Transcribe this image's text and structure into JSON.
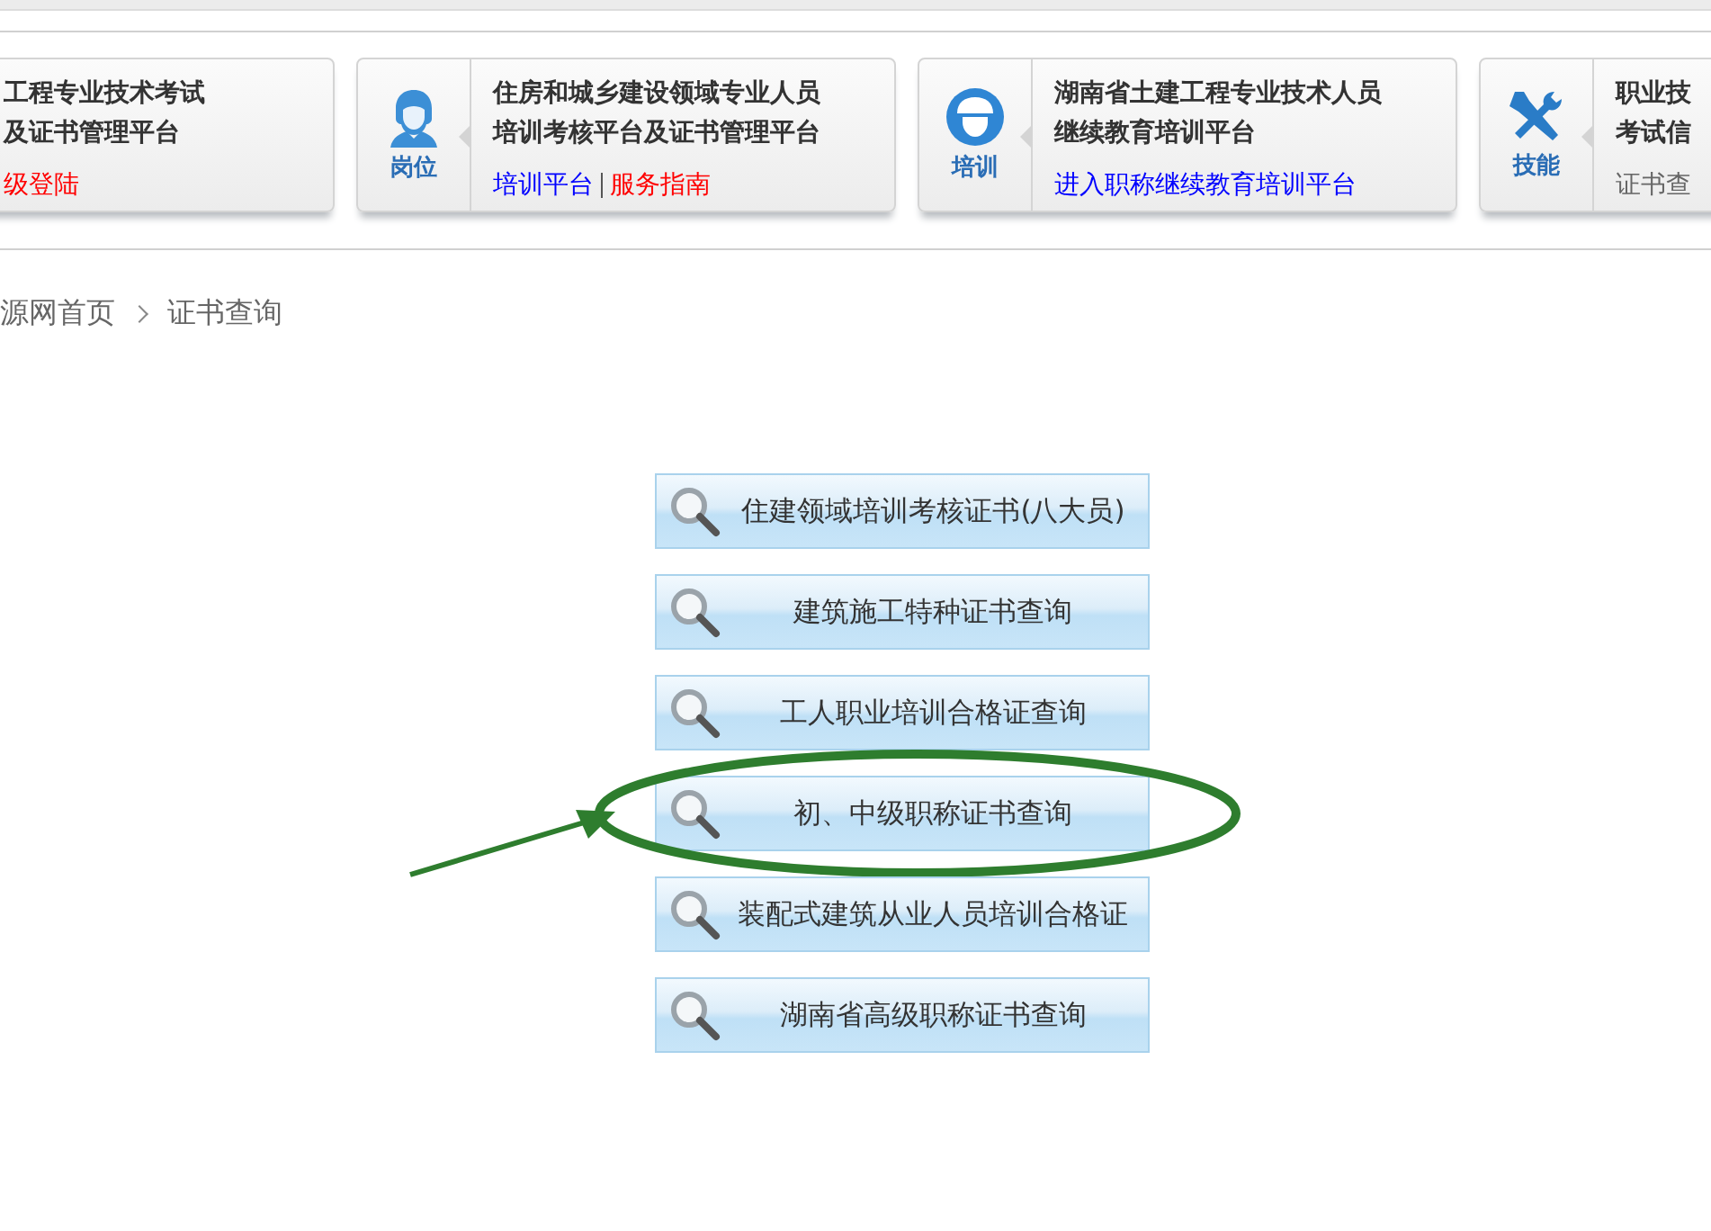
{
  "cards": [
    {
      "kind": "plain",
      "title": [
        "工程专业技术考试",
        "及证书管理平台"
      ],
      "links": [
        {
          "text": "级登陆",
          "color": "#ff0000"
        }
      ]
    },
    {
      "kind": "person",
      "icon_label": "岗位",
      "title": [
        "住房和城乡建设领域专业人员",
        "培训考核平台及证书管理平台"
      ],
      "links": [
        {
          "text": "培训平台",
          "color": "#0000ff"
        },
        {
          "text": "服务指南",
          "color": "#ff0000"
        }
      ]
    },
    {
      "kind": "helmet",
      "icon_label": "培训",
      "title": [
        "湖南省土建工程专业技术人员",
        "继续教育培训平台"
      ],
      "links": [
        {
          "text": "进入职称继续教育培训平台",
          "color": "#0000ff"
        }
      ]
    },
    {
      "kind": "tools",
      "icon_label": "技能",
      "title": [
        "职业技",
        "考试信"
      ],
      "links": [
        {
          "text": "证书查",
          "color": "#666666"
        }
      ]
    }
  ],
  "breadcrumb": [
    "源网首页",
    "证书查询"
  ],
  "query_buttons": [
    {
      "label": "住建领域培训考核证书(八大员)",
      "circled": false
    },
    {
      "label": "建筑施工特种证书查询",
      "circled": false
    },
    {
      "label": "工人职业培训合格证查询",
      "circled": false
    },
    {
      "label": "初、中级职称证书查询",
      "circled": true
    },
    {
      "label": "装配式建筑从业人员培训合格证",
      "circled": false
    },
    {
      "label": "湖南省高级职称证书查询",
      "circled": false
    }
  ]
}
